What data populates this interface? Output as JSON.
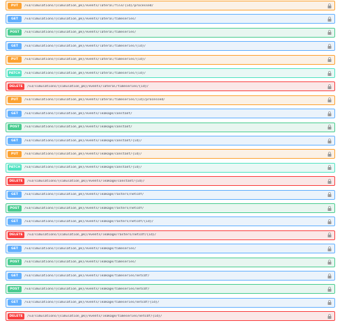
{
  "colors": {
    "GET": {
      "border": "#61affe",
      "bg": "#ebf3fb",
      "badge": "#61affe"
    },
    "POST": {
      "border": "#49cc90",
      "bg": "#e8f6f0",
      "badge": "#49cc90"
    },
    "PUT": {
      "border": "#fca130",
      "bg": "#fbf1e6",
      "badge": "#fca130"
    },
    "PATCH": {
      "border": "#50e3c2",
      "bg": "#e9f8f5",
      "badge": "#50e3c2"
    },
    "DELETE": {
      "border": "#f93e3e",
      "bg": "#fae7e7",
      "badge": "#f93e3e"
    }
  },
  "lock_icon": "lock-icon",
  "operations": [
    {
      "method": "PUT",
      "path": "/v3/simulations/{simulation_pk}/events/lateral/file/{id}/processed/"
    },
    {
      "method": "GET",
      "path": "/v3/simulations/{simulation_pk}/events/lateral/timeseries/"
    },
    {
      "method": "POST",
      "path": "/v3/simulations/{simulation_pk}/events/lateral/timeseries/"
    },
    {
      "method": "GET",
      "path": "/v3/simulations/{simulation_pk}/events/lateral/timeseries/{id}/"
    },
    {
      "method": "PUT",
      "path": "/v3/simulations/{simulation_pk}/events/lateral/timeseries/{id}/"
    },
    {
      "method": "PATCH",
      "path": "/v3/simulations/{simulation_pk}/events/lateral/timeseries/{id}/"
    },
    {
      "method": "DELETE",
      "path": "/v3/simulations/{simulation_pk}/events/lateral/timeseries/{id}/"
    },
    {
      "method": "PUT",
      "path": "/v3/simulations/{simulation_pk}/events/lateral/timeseries/{id}/processed/"
    },
    {
      "method": "GET",
      "path": "/v3/simulations/{simulation_pk}/events/leakage/constant/"
    },
    {
      "method": "POST",
      "path": "/v3/simulations/{simulation_pk}/events/leakage/constant/"
    },
    {
      "method": "GET",
      "path": "/v3/simulations/{simulation_pk}/events/leakage/constant/{id}/"
    },
    {
      "method": "PUT",
      "path": "/v3/simulations/{simulation_pk}/events/leakage/constant/{id}/"
    },
    {
      "method": "PATCH",
      "path": "/v3/simulations/{simulation_pk}/events/leakage/constant/{id}/"
    },
    {
      "method": "DELETE",
      "path": "/v3/simulations/{simulation_pk}/events/leakage/constant/{id}/"
    },
    {
      "method": "GET",
      "path": "/v3/simulations/{simulation_pk}/events/leakage/rasters/netcdf/"
    },
    {
      "method": "POST",
      "path": "/v3/simulations/{simulation_pk}/events/leakage/rasters/netcdf/"
    },
    {
      "method": "GET",
      "path": "/v3/simulations/{simulation_pk}/events/leakage/rasters/netcdf/{id}/"
    },
    {
      "method": "DELETE",
      "path": "/v3/simulations/{simulation_pk}/events/leakage/rasters/netcdf/{id}/"
    },
    {
      "method": "GET",
      "path": "/v3/simulations/{simulation_pk}/events/leakage/timeseries/"
    },
    {
      "method": "POST",
      "path": "/v3/simulations/{simulation_pk}/events/leakage/timeseries/"
    },
    {
      "method": "GET",
      "path": "/v3/simulations/{simulation_pk}/events/leakage/timeseries/netcdf/"
    },
    {
      "method": "POST",
      "path": "/v3/simulations/{simulation_pk}/events/leakage/timeseries/netcdf/"
    },
    {
      "method": "GET",
      "path": "/v3/simulations/{simulation_pk}/events/leakage/timeseries/netcdf/{id}/"
    },
    {
      "method": "DELETE",
      "path": "/v3/simulations/{simulation_pk}/events/leakage/timeseries/netcdf/{id}/"
    }
  ]
}
